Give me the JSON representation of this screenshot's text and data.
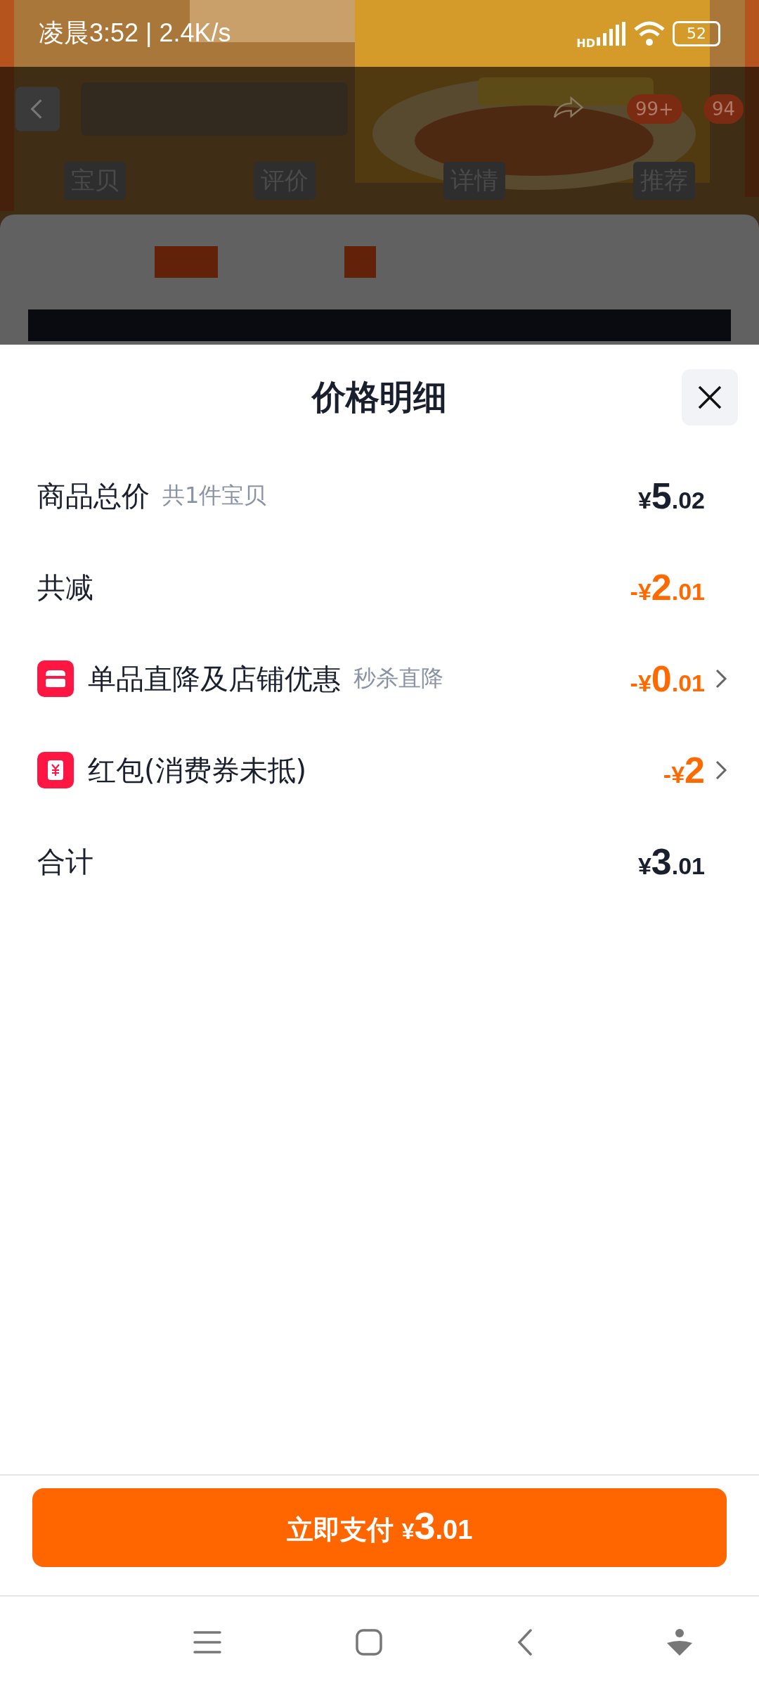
{
  "status_bar": {
    "time": "凌晨3:52 | 2.4K/s",
    "network": "HD",
    "battery": "52"
  },
  "background_page": {
    "badges": [
      "99+",
      "94"
    ],
    "tabs": [
      "宝贝",
      "评价",
      "详情",
      "推荐"
    ]
  },
  "sheet": {
    "title": "价格明细",
    "rows": [
      {
        "kind": "plain",
        "label": "商品总价",
        "note": "共1件宝贝",
        "amount": "¥5.02",
        "accent": false,
        "chevron": false
      },
      {
        "kind": "plain",
        "label": "共减",
        "amount": "-¥2.01",
        "accent": true,
        "chevron": false
      },
      {
        "kind": "shop",
        "label": "单品直降及店铺优惠",
        "note": "秒杀直降",
        "amount": "-¥0.01",
        "accent": true,
        "chevron": true
      },
      {
        "kind": "coupon",
        "label": "红包(消费券未抵)",
        "amount": "-¥2",
        "accent": true,
        "chevron": true
      },
      {
        "kind": "plain",
        "label": "合计",
        "amount": "¥3.01",
        "accent": false,
        "chevron": false
      }
    ],
    "pay_button": {
      "label": "立即支付",
      "amount": "¥3.01"
    }
  }
}
